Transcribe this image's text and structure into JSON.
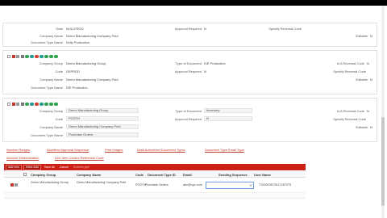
{
  "panel1": {
    "date_label": "Date",
    "date_value": "NULLFROO",
    "approval_required_label": "Approval Required",
    "approval_required_value": "N",
    "specify_reversal_label": "Specify Reversal Code",
    "company_name_label": "Company Name",
    "company_name_value": "Demo Manufacturing Company Publ",
    "editable_label": "Editable",
    "editable_value": "N",
    "doc_type_name_label": "Document Type Name",
    "doc_type_name_value": "Kelly Production"
  },
  "panel2": {
    "company_group_label": "Company Group",
    "company_group_value": "Demo Manufacturing Group",
    "doc_type_label": "Type of Document",
    "doc_type_value": "ISE Production",
    "reversal_code_label": "Is A Reversal Code",
    "reversal_code_value": "N",
    "code_label": "Code",
    "code_value": "DEPROD",
    "approval_required_label": "Approval Required",
    "approval_required_value": "N",
    "specify_reversal_label": "Specify Reversal Code",
    "company_name_label": "Company Name",
    "company_name_value": "Demo Manufacturing Company Publ",
    "editable_label": "Editable",
    "editable_value": "N",
    "doc_type_name_label": "Document Type Name",
    "doc_type_name_value": "ISE Production"
  },
  "panel3": {
    "company_group_label": "Company Group",
    "company_group_value": "Demo Manufacturing Group",
    "doc_type_label": "Type of Document",
    "doc_type_value": "Inventory",
    "reversal_code_label": "Is A Reversal Code",
    "reversal_code_value": "N",
    "code_label": "Code",
    "code_value": "POOTH",
    "approval_required_label": "Approval Required",
    "approval_required_value": "N",
    "specify_reversal_label": "Specify Reversal Code",
    "company_name_label": "Company Name",
    "company_name_value": "Demo Manufacturing Company Publ",
    "editable_label": "Editable",
    "editable_value": "N",
    "doc_type_name_label": "Document Type Name",
    "doc_type_name_value": "Purchase Orders"
  },
  "links": [
    "Number Ranges",
    "Workflow Approval Sequence",
    "Print Images",
    "Draft Authorized Document Types",
    "Document Type Email Type",
    "Account Determination",
    "Line Item Control Reference Code"
  ],
  "toolbar": {
    "add_new": "Add new",
    "inline_add": "Inline Add",
    "save_all": "Save All",
    "cancel": "Cancel",
    "hint": "Refresh grid"
  },
  "grid": {
    "headers": [
      "Company Group",
      "Company Name",
      "Code",
      "Document Type ID",
      "Email",
      "Sending Sequence",
      "User Name"
    ],
    "row": {
      "company_group": "Demo Manufacturing Group",
      "company_name": "Demo Manufacturing Company Publ",
      "code": "POOTH",
      "doc_type_id": "Purchase Orders",
      "email": "abc@xyz.com",
      "sending_sequence": "0",
      "user_name": "7100003572617267079"
    }
  },
  "colors": {
    "toolbar_red": "#cc1f16",
    "link_red": "#c0392b",
    "icon_green": "#2ea44f",
    "icon_teal": "#1e9c8f",
    "icon_red": "#d63b2f"
  }
}
